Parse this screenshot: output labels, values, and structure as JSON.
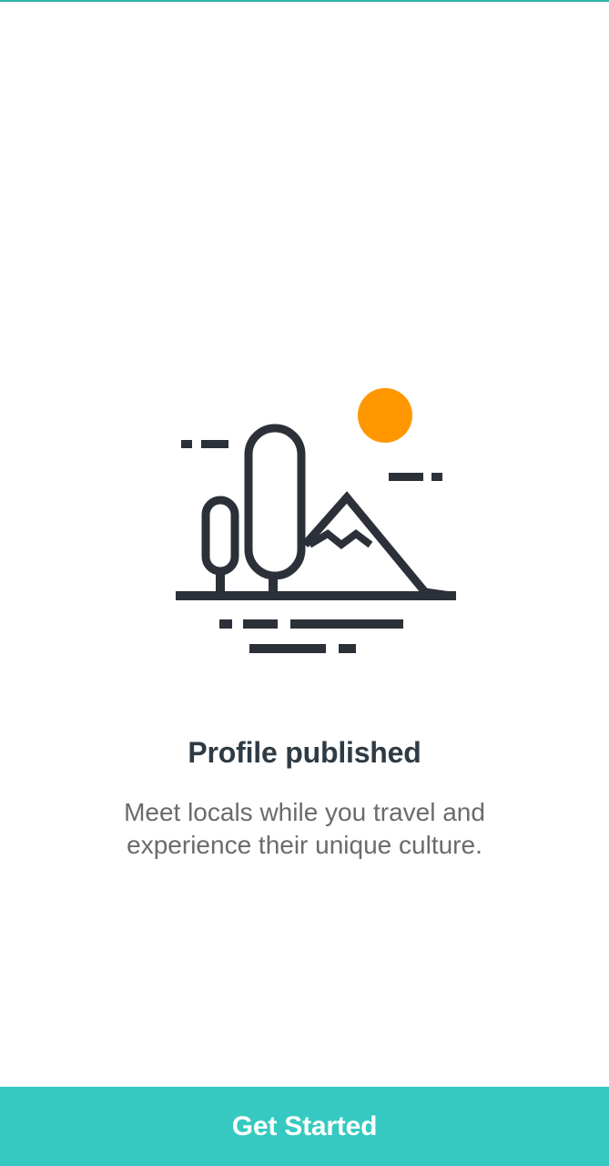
{
  "screen": {
    "title": "Profile published",
    "description": "Meet locals while you travel and experience their unique culture.",
    "cta_label": "Get Started"
  },
  "illustration": {
    "icon": "landscape-trees-mountain-sun-icon",
    "colors": {
      "stroke": "#2c3038",
      "sun": "#ff9800"
    }
  },
  "theme": {
    "accent": "#35c9c1",
    "title_color": "#2f3b44",
    "body_color": "#6b6b6b"
  }
}
